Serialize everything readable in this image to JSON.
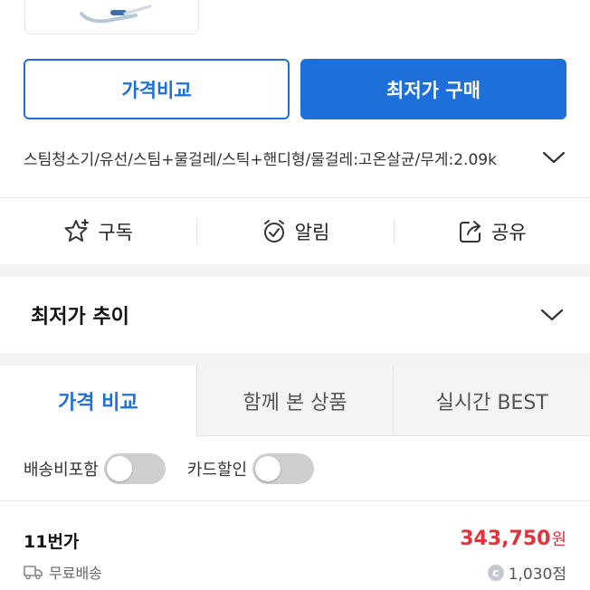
{
  "buttons": {
    "compare_label": "가격비교",
    "buy_label": "최저가 구매"
  },
  "spec_text": "스팀청소기/유선/스팀+물걸레/스틱+핸디형/물걸레:고온살균/무게:2.09k",
  "actions": {
    "subscribe_label": "구독",
    "alarm_label": "알림",
    "share_label": "공유"
  },
  "price_trend": {
    "title": "최저가 추이"
  },
  "tabs": [
    {
      "label": "가격 비교",
      "active": true
    },
    {
      "label": "함께 본 상품",
      "active": false
    },
    {
      "label": "실시간 BEST",
      "active": false
    }
  ],
  "filters": {
    "shipping_included_label": "배송비포함",
    "shipping_included_on": false,
    "card_discount_label": "카드할인",
    "card_discount_on": false
  },
  "offer": {
    "seller": "11번가",
    "shipping": "무료배송",
    "price": "343,750",
    "price_unit": "원",
    "points": "1,030점"
  },
  "colors": {
    "accent": "#1e6fd9",
    "price": "#e0333d"
  }
}
